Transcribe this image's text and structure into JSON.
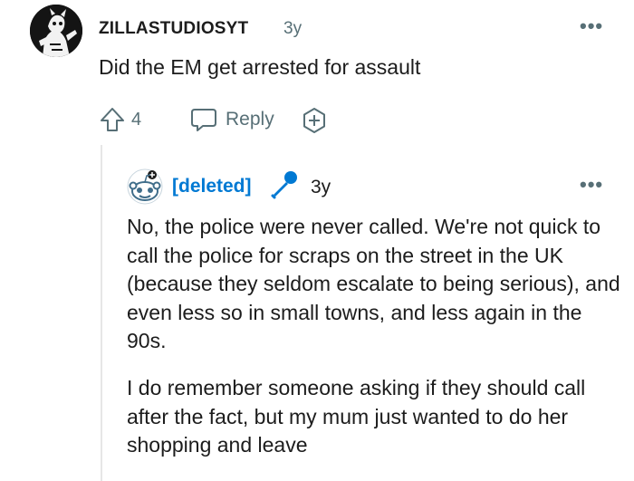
{
  "comment": {
    "username": "ZILLASTUDIOSYT",
    "age": "3y",
    "body": "Did the EM get arrested for assault",
    "vote_count": "4",
    "reply_label": "Reply",
    "avatar_icon": "cartoon-character-avatar-icon"
  },
  "reply": {
    "username": "[deleted]",
    "age": "3y",
    "flair_icon": "microphone-icon",
    "avatar_icon": "reddit-snoo-avatar-icon",
    "username_color": "#0079d3",
    "paragraphs": [
      "No, the police were never called. We're not quick to call the police for scraps on the street in the UK (because they seldom escalate to being serious), and even less so in small towns, and less again in the 90s.",
      "I do remember someone asking if they should call after the fact, but my mum just wanted to do her shopping and leave"
    ]
  },
  "ui": {
    "more_glyph": "•••",
    "muted_color": "#576f76"
  }
}
